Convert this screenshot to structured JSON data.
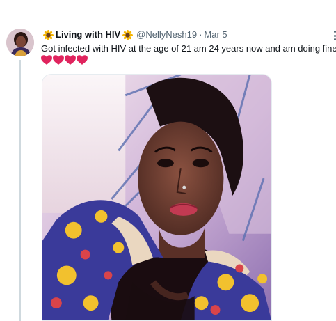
{
  "tweet": {
    "display_name": "Living with HIV",
    "handle": "@NellyNesh19",
    "separator": "·",
    "date": "Mar 5",
    "text": "Got infected with HIV at the age of 21 am 24 years now and am doing fine",
    "emoji_name_prefix": "sunflower-icon",
    "emoji_name_suffix": "sunflower-icon",
    "hearts": [
      "red-heart-icon",
      "red-heart-icon",
      "red-heart-icon",
      "red-heart-icon"
    ],
    "media_alt": "selfie photo"
  },
  "colors": {
    "text_primary": "#0f1419",
    "text_secondary": "#536471",
    "heart_red": "#e0245e",
    "thread_line": "#cfd9de"
  }
}
